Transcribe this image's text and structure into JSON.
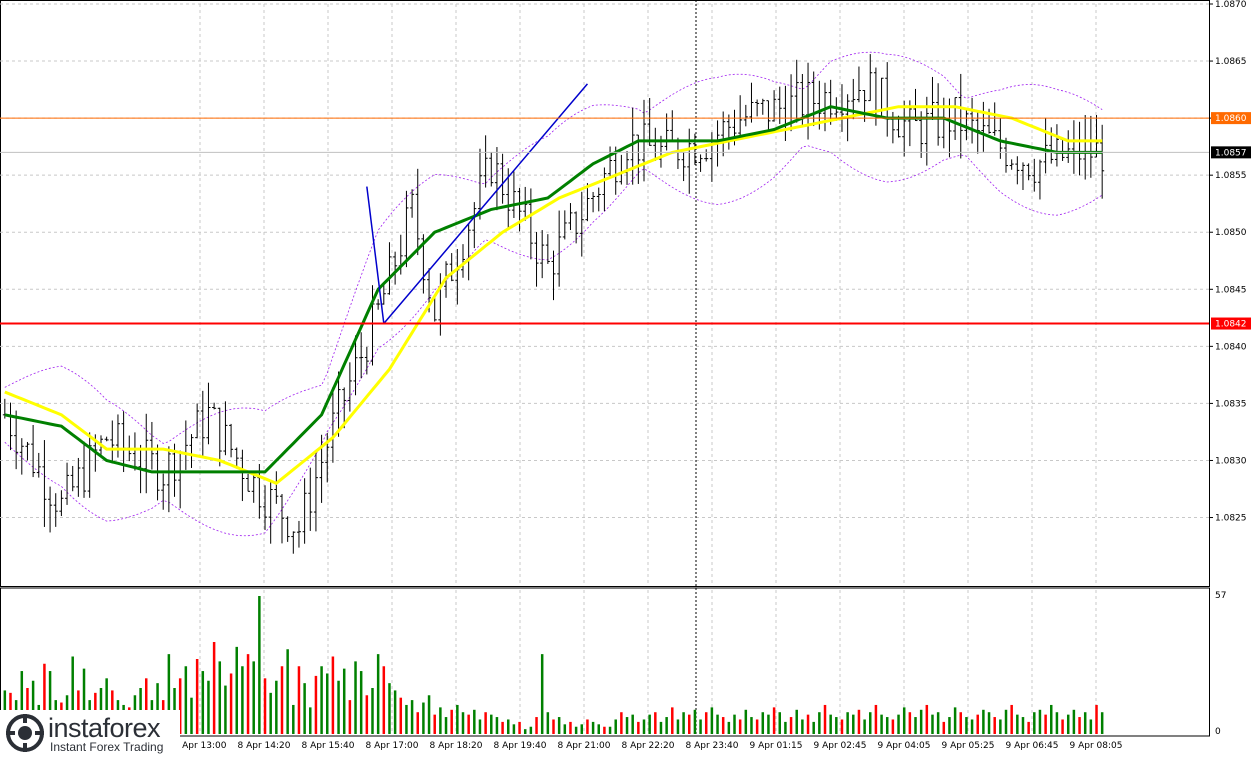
{
  "chart_data": {
    "type": "candlestick",
    "price_axis": {
      "min": 1.0819,
      "max": 1.087,
      "ticks": [
        "1.0870",
        "1.0865",
        "1.0860",
        "1.0855",
        "1.0850",
        "1.0845",
        "1.0840",
        "1.0835",
        "1.0830",
        "1.0825"
      ]
    },
    "volume_axis": {
      "min": 0,
      "max": 57,
      "ticks": [
        "57",
        "0"
      ]
    },
    "time_labels": [
      "8 Apr 13:00",
      "8 Apr 14:20",
      "8 Apr 15:40",
      "8 Apr 17:00",
      "8 Apr 18:20",
      "8 Apr 19:40",
      "8 Apr 21:00",
      "8 Apr 22:20",
      "8 Apr 23:40",
      "9 Apr 01:15",
      "9 Apr 02:45",
      "9 Apr 04:05",
      "9 Apr 05:25",
      "9 Apr 06:45",
      "9 Apr 08:05"
    ],
    "current_price": {
      "label": "1.0857",
      "value": 1.0857
    },
    "levels": [
      {
        "label": "1.0860",
        "value": 1.086,
        "color": "#ff6a00",
        "weight": "thin"
      },
      {
        "label": "1.0842",
        "value": 1.0842,
        "color": "#ff0000",
        "weight": "thick"
      }
    ],
    "price_path": [
      [
        0,
        1.0834
      ],
      [
        10,
        1.0826
      ],
      [
        18,
        1.0832
      ],
      [
        28,
        1.0829
      ],
      [
        36,
        1.0834
      ],
      [
        44,
        1.0828
      ],
      [
        52,
        1.0824
      ],
      [
        58,
        1.0833
      ],
      [
        66,
        1.0843
      ],
      [
        72,
        1.0852
      ],
      [
        76,
        1.0843
      ],
      [
        86,
        1.0856
      ],
      [
        96,
        1.0847
      ],
      [
        110,
        1.0858
      ],
      [
        116,
        1.0857
      ],
      [
        124,
        1.0858
      ],
      [
        130,
        1.086
      ],
      [
        138,
        1.0861
      ],
      [
        146,
        1.0862
      ],
      [
        152,
        1.0863
      ],
      [
        160,
        1.0859
      ],
      [
        168,
        1.086
      ],
      [
        174,
        1.0858
      ],
      [
        182,
        1.0856
      ],
      [
        190,
        1.0857
      ],
      [
        196,
        1.0857
      ]
    ],
    "ma_fast": [
      [
        0,
        1.0834
      ],
      [
        10,
        1.0833
      ],
      [
        18,
        1.083
      ],
      [
        26,
        1.0829
      ],
      [
        36,
        1.0829
      ],
      [
        46,
        1.0829
      ],
      [
        56,
        1.0834
      ],
      [
        66,
        1.0845
      ],
      [
        76,
        1.085
      ],
      [
        86,
        1.0852
      ],
      [
        96,
        1.0853
      ],
      [
        104,
        1.0856
      ],
      [
        112,
        1.0858
      ],
      [
        118,
        1.0858
      ],
      [
        126,
        1.0858
      ],
      [
        136,
        1.0859
      ],
      [
        146,
        1.0861
      ],
      [
        156,
        1.086
      ],
      [
        166,
        1.086
      ],
      [
        176,
        1.0858
      ],
      [
        186,
        1.0857
      ],
      [
        196,
        1.0857
      ]
    ],
    "ma_slow": [
      [
        0,
        1.0836
      ],
      [
        10,
        1.0834
      ],
      [
        18,
        1.0831
      ],
      [
        28,
        1.0831
      ],
      [
        38,
        1.083
      ],
      [
        48,
        1.0828
      ],
      [
        58,
        1.0832
      ],
      [
        68,
        1.0838
      ],
      [
        78,
        1.0846
      ],
      [
        88,
        1.085
      ],
      [
        98,
        1.0853
      ],
      [
        108,
        1.0855
      ],
      [
        118,
        1.0857
      ],
      [
        128,
        1.0858
      ],
      [
        138,
        1.0859
      ],
      [
        148,
        1.086
      ],
      [
        158,
        1.0861
      ],
      [
        168,
        1.0861
      ],
      [
        178,
        1.086
      ],
      [
        188,
        1.0858
      ],
      [
        196,
        1.0858
      ]
    ],
    "bollinger_band_width": 0.0004,
    "trendlines": [
      {
        "from": [
          64,
          1.0854
        ],
        "to": [
          67,
          1.0842
        ]
      },
      {
        "from": [
          67,
          1.0842
        ],
        "to": [
          103,
          1.0863
        ]
      }
    ],
    "volume_values": [
      18,
      17,
      14,
      26,
      19,
      22,
      12,
      29,
      26,
      14,
      13,
      16,
      32,
      18,
      27,
      14,
      17,
      19,
      23,
      18,
      14,
      12,
      11,
      16,
      19,
      23,
      14,
      21,
      14,
      33,
      19,
      23,
      28,
      15,
      31,
      26,
      22,
      38,
      30,
      20,
      25,
      36,
      28,
      33,
      30,
      57,
      23,
      17,
      22,
      28,
      35,
      12,
      28,
      21,
      11,
      24,
      28,
      25,
      32,
      22,
      27,
      14,
      30,
      26,
      16,
      19,
      33,
      28,
      21,
      18,
      15,
      12,
      14,
      9,
      13,
      16,
      8,
      11,
      7,
      10,
      12,
      9,
      8,
      10,
      6,
      9,
      8,
      7,
      5,
      6,
      4,
      5,
      2,
      3,
      7,
      33,
      9,
      6,
      7,
      4,
      5,
      3,
      4,
      6,
      5,
      4,
      3,
      3,
      6,
      9,
      7,
      8,
      5,
      6,
      8,
      9,
      5,
      7,
      11,
      6,
      9,
      8,
      10,
      6,
      9,
      11,
      8,
      7,
      5,
      8,
      6,
      10,
      7,
      6,
      9,
      8,
      11,
      9,
      5,
      7,
      10,
      6,
      8,
      5,
      9,
      12,
      8,
      7,
      6,
      9,
      8,
      10,
      6,
      9,
      12,
      8,
      7,
      6,
      8,
      11,
      9,
      7,
      10,
      12,
      8,
      9,
      5,
      7,
      11,
      9,
      7,
      6,
      8,
      10,
      9,
      7,
      6,
      10,
      12,
      8,
      7,
      5,
      9,
      10,
      8,
      12,
      9,
      6,
      8,
      10,
      7,
      9,
      6,
      12,
      9
    ]
  },
  "branding": {
    "name": "instaforex",
    "tagline": "Instant Forex Trading"
  },
  "colors": {
    "bull_candle": "#000000",
    "bear_candle": "#000000",
    "ma_fast": "#008000",
    "ma_slow": "#ffff00",
    "bollinger": "#a020f0",
    "trendline": "#0000cc",
    "volume_up": "#008000",
    "volume_down": "#ff0000",
    "grid": "#c8c8c8",
    "axis": "#000000"
  }
}
